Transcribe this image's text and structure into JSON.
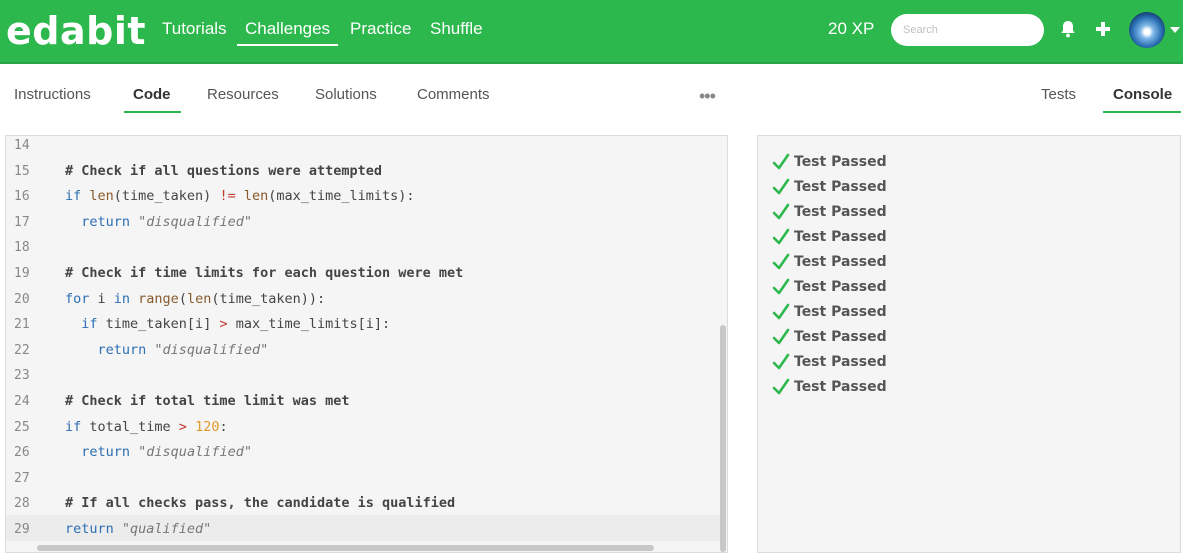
{
  "app": {
    "logo": "edabit",
    "nav": [
      {
        "label": "Tutorials"
      },
      {
        "label": "Challenges"
      },
      {
        "label": "Practice"
      },
      {
        "label": "Shuffle"
      }
    ],
    "xp": "20 XP",
    "search_placeholder": "Search"
  },
  "tabs": {
    "left": [
      "Instructions",
      "Code",
      "Resources",
      "Solutions",
      "Comments"
    ],
    "more": "•••",
    "right": [
      "Tests",
      "Console"
    ]
  },
  "editor": {
    "lines": [
      {
        "n": "14",
        "segs": []
      },
      {
        "n": "15",
        "segs": [
          {
            "t": "# Check if all questions were attempted",
            "c": "c-com"
          }
        ]
      },
      {
        "n": "16",
        "segs": [
          {
            "t": "if ",
            "c": "c-kw"
          },
          {
            "t": "len",
            "c": "c-fn"
          },
          {
            "t": "(time_taken) ",
            "c": ""
          },
          {
            "t": "!=",
            "c": "c-op"
          },
          {
            "t": " ",
            "c": ""
          },
          {
            "t": "len",
            "c": "c-fn"
          },
          {
            "t": "(max_time_limits):",
            "c": ""
          }
        ]
      },
      {
        "n": "17",
        "segs": [
          {
            "t": "  ",
            "c": ""
          },
          {
            "t": "return ",
            "c": "c-kw"
          },
          {
            "t": "\"disqualified\"",
            "c": "c-str"
          }
        ]
      },
      {
        "n": "18",
        "segs": []
      },
      {
        "n": "19",
        "segs": [
          {
            "t": "# Check if time limits for each question were met",
            "c": "c-com"
          }
        ]
      },
      {
        "n": "20",
        "segs": [
          {
            "t": "for ",
            "c": "c-kw"
          },
          {
            "t": "i ",
            "c": ""
          },
          {
            "t": "in ",
            "c": "c-kw"
          },
          {
            "t": "range",
            "c": "c-fn"
          },
          {
            "t": "(",
            "c": ""
          },
          {
            "t": "len",
            "c": "c-fn"
          },
          {
            "t": "(time_taken)):",
            "c": ""
          }
        ]
      },
      {
        "n": "21",
        "segs": [
          {
            "t": "  ",
            "c": ""
          },
          {
            "t": "if ",
            "c": "c-kw"
          },
          {
            "t": "time_taken[i] ",
            "c": ""
          },
          {
            "t": ">",
            "c": "c-op"
          },
          {
            "t": " max_time_limits[i]:",
            "c": ""
          }
        ]
      },
      {
        "n": "22",
        "segs": [
          {
            "t": "    ",
            "c": ""
          },
          {
            "t": "return ",
            "c": "c-kw"
          },
          {
            "t": "\"disqualified\"",
            "c": "c-str"
          }
        ]
      },
      {
        "n": "23",
        "segs": []
      },
      {
        "n": "24",
        "segs": [
          {
            "t": "# Check if total time limit was met",
            "c": "c-com"
          }
        ]
      },
      {
        "n": "25",
        "segs": [
          {
            "t": "if ",
            "c": "c-kw"
          },
          {
            "t": "total_time ",
            "c": ""
          },
          {
            "t": ">",
            "c": "c-op"
          },
          {
            "t": " ",
            "c": ""
          },
          {
            "t": "120",
            "c": "c-num"
          },
          {
            "t": ":",
            "c": ""
          }
        ]
      },
      {
        "n": "26",
        "segs": [
          {
            "t": "  ",
            "c": ""
          },
          {
            "t": "return ",
            "c": "c-kw"
          },
          {
            "t": "\"disqualified\"",
            "c": "c-str"
          }
        ]
      },
      {
        "n": "27",
        "segs": []
      },
      {
        "n": "28",
        "segs": [
          {
            "t": "# If all checks pass, the candidate is qualified",
            "c": "c-com"
          }
        ]
      },
      {
        "n": "29",
        "segs": [
          {
            "t": "return ",
            "c": "c-kw"
          },
          {
            "t": "\"qualified\"",
            "c": "c-str"
          }
        ]
      }
    ]
  },
  "console": {
    "results": [
      "Test Passed",
      "Test Passed",
      "Test Passed",
      "Test Passed",
      "Test Passed",
      "Test Passed",
      "Test Passed",
      "Test Passed",
      "Test Passed",
      "Test Passed"
    ]
  },
  "colors": {
    "brand": "#2db84d",
    "check": "#2db84d"
  }
}
